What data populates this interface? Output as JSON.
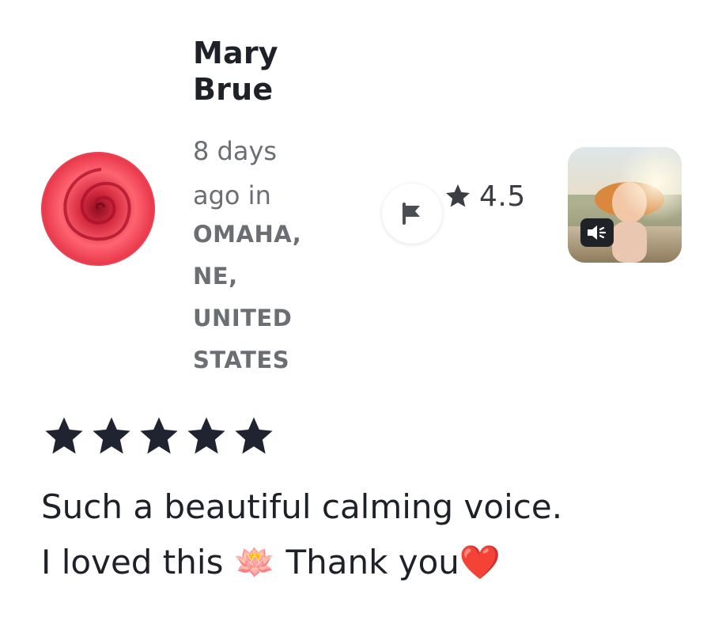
{
  "review": {
    "reviewer_name": "Mary\nBrue",
    "time_text": "8 days\nago in",
    "location": "OMAHA,\nNE,\nUNITED\nSTATES",
    "rating_value": "4.5",
    "user_stars": 5,
    "body": "Such a beautiful calming voice. I loved this 🪷 Thank you❤️"
  },
  "icons": {
    "flag": "flag-icon",
    "rating_star": "star-icon",
    "audio": "speaker-icon"
  },
  "colors": {
    "text_dark": "#1f2128",
    "text_muted": "#6b6e73",
    "star": "#1f2430"
  }
}
